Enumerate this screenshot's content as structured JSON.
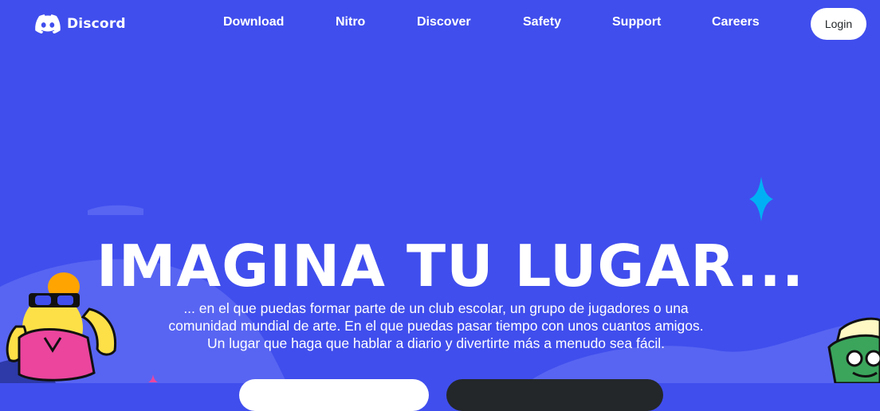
{
  "nav": {
    "brand": "Discord",
    "links": [
      "Download",
      "Nitro",
      "Discover",
      "Safety",
      "Support",
      "Careers"
    ],
    "login_label": "Login"
  },
  "hero": {
    "title": "IMAGINA TU LUGAR...",
    "lines": [
      "... en el que puedas formar parte de un club escolar, un grupo de jugadores o una",
      "comunidad mundial de arte. En el que puedas pasar tiempo con unos cuantos amigos.",
      "Un lugar que haga que hablar a diario y divertirte más a menudo sea fácil."
    ]
  },
  "colors": {
    "background": "#404eed",
    "hills": "#5865f2",
    "sparkle": "#00b0f4",
    "white": "#ffffff",
    "dark": "#23272a"
  },
  "icons": [
    "discord-logo-icon",
    "sparkle-icon"
  ]
}
